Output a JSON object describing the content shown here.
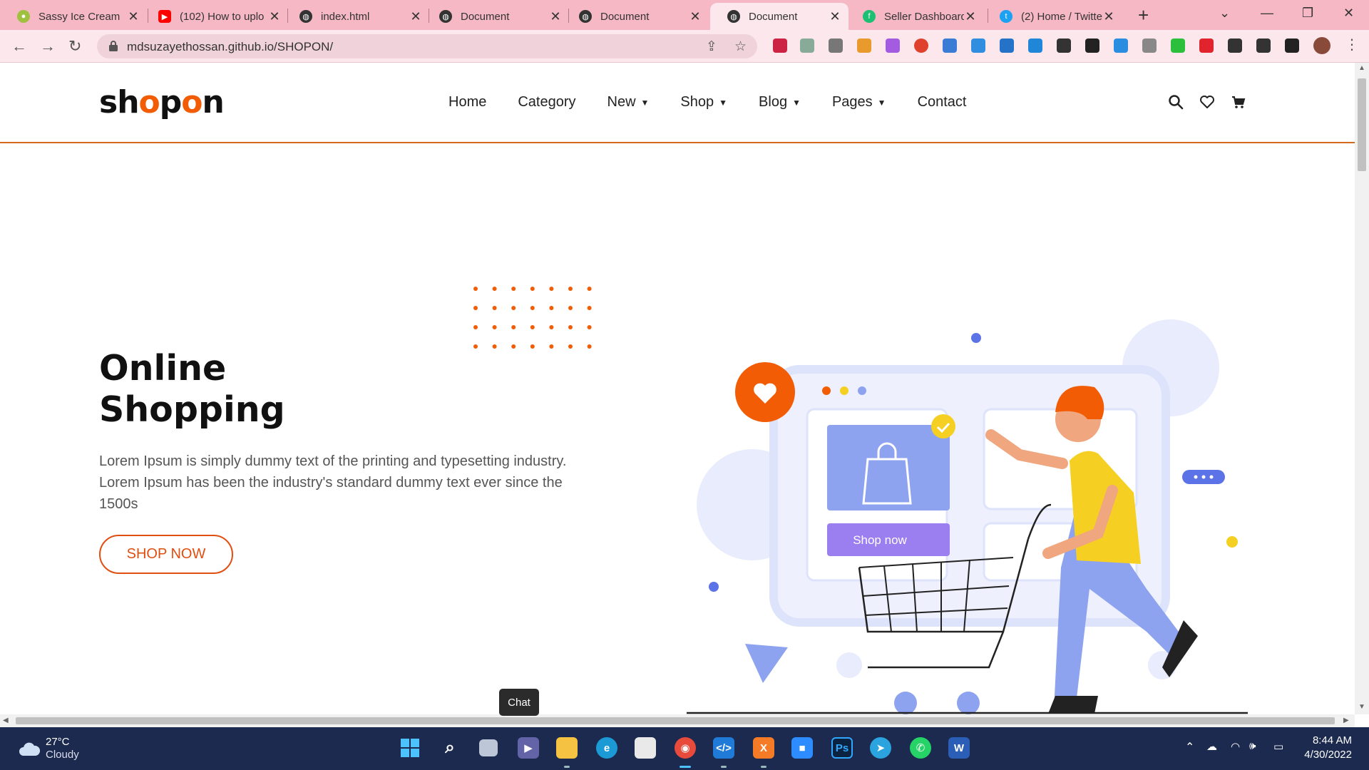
{
  "browser": {
    "tabs": [
      {
        "title": "Sassy Ice Cream",
        "icon": "ice-cream-icon",
        "color": "#a0c040"
      },
      {
        "title": "(102) How to uplo",
        "icon": "youtube-icon",
        "color": "#ff0000"
      },
      {
        "title": "index.html",
        "icon": "globe-icon",
        "color": "#333333"
      },
      {
        "title": "Document",
        "icon": "globe-icon",
        "color": "#333333"
      },
      {
        "title": "Document",
        "icon": "globe-icon",
        "color": "#333333"
      },
      {
        "title": "Document",
        "icon": "globe-icon",
        "color": "#333333",
        "active": true
      },
      {
        "title": "Seller Dashboard",
        "icon": "fiverr-icon",
        "color": "#1dbf73"
      },
      {
        "title": "(2) Home / Twitte",
        "icon": "twitter-icon",
        "color": "#1da1f2"
      }
    ],
    "url": "mdsuzayethossan.github.io/SHOPON/"
  },
  "site": {
    "logo": {
      "pre": "sh",
      "o1": "o",
      "mid": "p",
      "o2": "o",
      "post": "n"
    },
    "nav": [
      {
        "label": "Home",
        "dropdown": false
      },
      {
        "label": "Category",
        "dropdown": false
      },
      {
        "label": "New",
        "dropdown": true
      },
      {
        "label": "Shop",
        "dropdown": true
      },
      {
        "label": "Blog",
        "dropdown": true
      },
      {
        "label": "Pages",
        "dropdown": true
      },
      {
        "label": "Contact",
        "dropdown": false
      }
    ],
    "accent": "#f25c05",
    "hero": {
      "title_line1": "Online",
      "title_line2": "Shopping",
      "text": "Lorem Ipsum is simply dummy text of the printing and typesetting industry. Lorem Ipsum has been the industry's standard dummy text ever since the 1500s",
      "button": "SHOP NOW"
    },
    "illustration": {
      "card_button": "Shop now"
    }
  },
  "taskbar": {
    "weather": {
      "temp": "27°C",
      "condition": "Cloudy"
    },
    "tooltip": "Chat",
    "time": "8:44 AM",
    "date": "4/30/2022"
  }
}
